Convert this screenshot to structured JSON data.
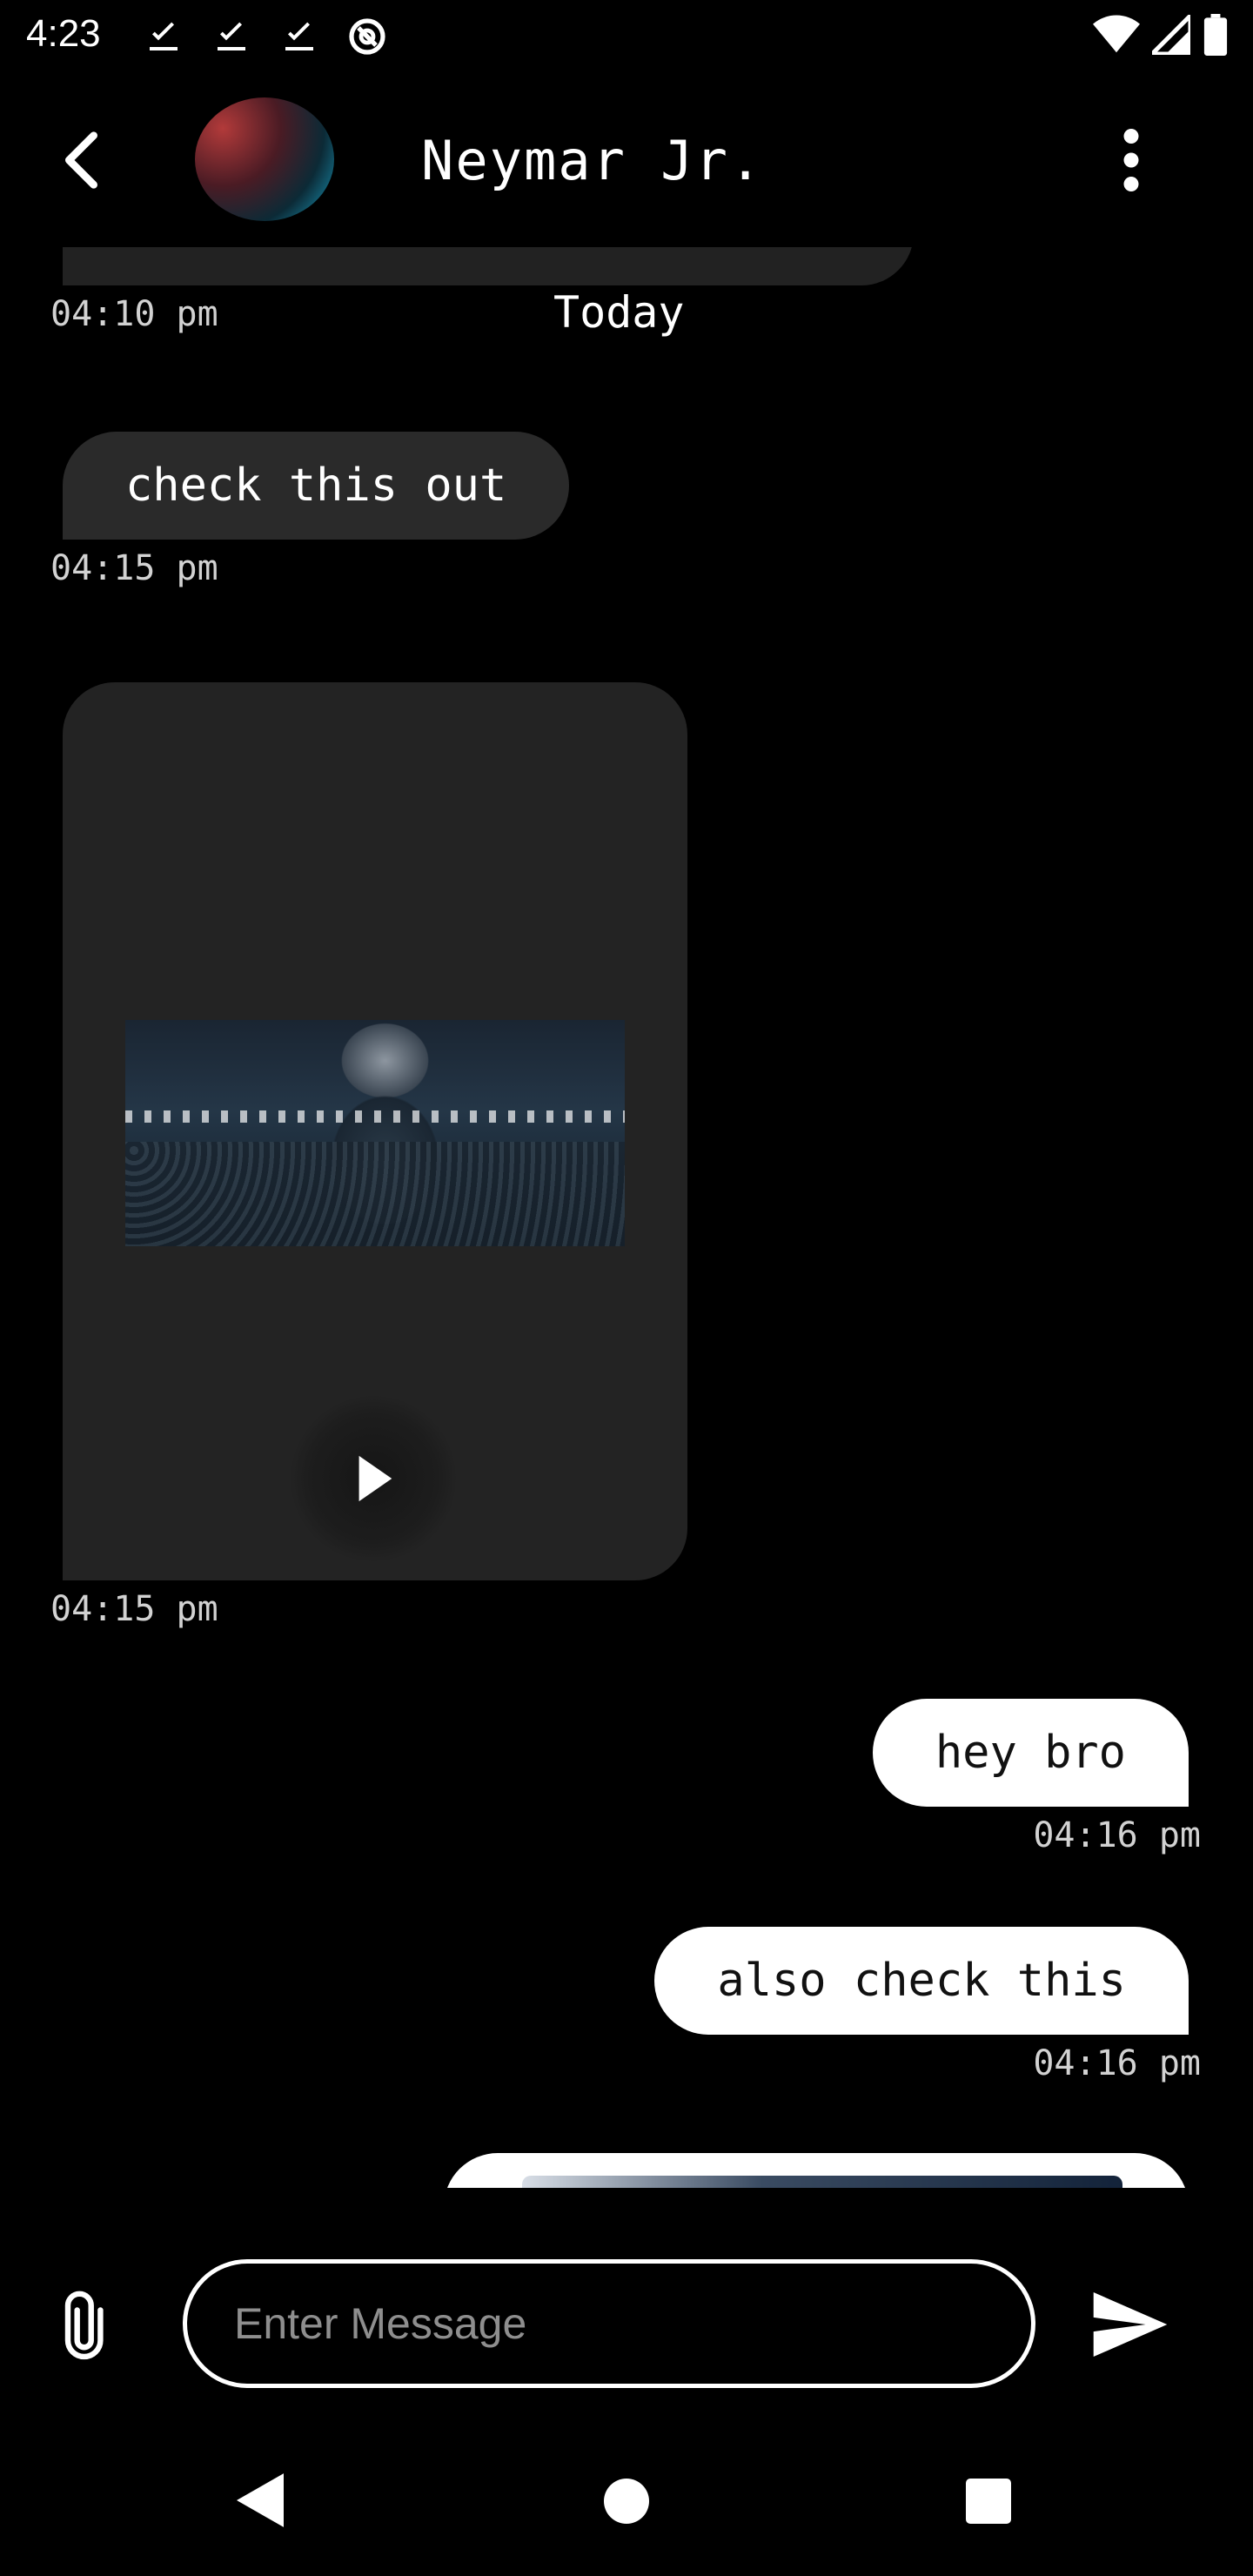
{
  "status_bar": {
    "time": "4:23"
  },
  "header": {
    "contact_name": "Neymar Jr."
  },
  "chat": {
    "partial_top_timestamp": "04:10 pm",
    "day_separator": "Today",
    "messages": [
      {
        "direction": "incoming",
        "type": "text",
        "text": "check this out",
        "time": "04:15 pm"
      },
      {
        "direction": "incoming",
        "type": "video",
        "time": "04:15 pm"
      },
      {
        "direction": "outgoing",
        "type": "text",
        "text": "hey bro",
        "time": "04:16 pm"
      },
      {
        "direction": "outgoing",
        "type": "text",
        "text": "also check this",
        "time": "04:16 pm"
      }
    ]
  },
  "composer": {
    "placeholder": "Enter Message"
  },
  "colors": {
    "background": "#000000",
    "incoming_bubble": "#2a2a2a",
    "outgoing_bubble": "#ffffff",
    "accent": "#18c7ef"
  }
}
